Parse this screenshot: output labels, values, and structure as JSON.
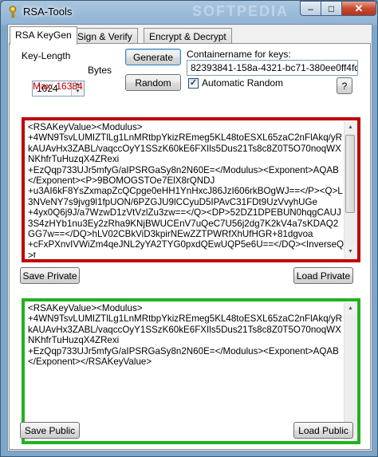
{
  "window": {
    "title": "RSA-Tools",
    "watermark": "SOFTPEDIA",
    "minimize_glyph": "–",
    "maximize_glyph": "□",
    "close_glyph": "✕"
  },
  "tabs": [
    {
      "label": "RSA KeyGen",
      "active": true
    },
    {
      "label": "Sign & Verify",
      "active": false
    },
    {
      "label": "Encrypt & Decrypt",
      "active": false
    }
  ],
  "keygen": {
    "key_length_label": "Key-Length",
    "key_length_value": "1024",
    "bytes_label": "Bytes",
    "max_label": "Max: 16384",
    "generate_button": "Generate",
    "random_button": "Random",
    "container_label": "Containername for keys:",
    "container_value": "82393841-158a-4321-bc71-380ee0ff4fd4",
    "auto_random_label": "Automatic Random",
    "auto_random_checked": true,
    "help_button": "?"
  },
  "private_key": {
    "text": "<RSAKeyValue><Modulus>\n+4WN9TsvLUMIZTlLg1LnMRtbpYkizREmeg5KL48toESXL65zaC2nFlAkq/yRkAUAvHx3ZABL/vaqccOyY1SSzK60kE6FXIls5Dus21Ts8c8Z0T5O70noqWXNKhfrTuHuzqX4ZRexi\n+EzQqp733UJr5mfyG/aIPSRGaSy8n2N60E=</Modulus><Exponent>AQAB</Exponent><P>9BOMOGSTOe7ElX8rQNDJ\n+u3AI6kF8YsZxmapZcQCpge0eHH1YnHxcJ86JzI606rkBOgWJ==</P><Q>L3NVeNY7s9jvg9l1fpUON/6PZGJU9lCCyuD5IPAvC31FDt9UzVvyhUGe\n+4yx0Q6j9J/a7WzwD1zVtVzlZu3zw==</Q><DP>52DZ1DPEBUN0hqgCAUJ3S4zHYb1nu3Ey2zRha9KNjBWUCEnV7uQeC7U56j2dg7K2kV4a7sKDAQ2GG7w==</DQ>hLV02CBkViD3kpirNEwZZTPWRfXhUfHGR+81dgvoa\n+cFxPXnvIVWiZm4qeJNL2yYA2TYG0pxdQEwUQP5e6U==</DQ><InverseQ>t"
  },
  "private_buttons": {
    "save": "Save Private",
    "load": "Load Private"
  },
  "public_key": {
    "text": "<RSAKeyValue><Modulus>\n+4WN9TsvLUMIZTlLg1LnMRtbpYkizREmeg5KL48toESXL65zaC2nFlAkq/yRkAUAvHx3ZABL/vaqccOyY1SSzK60kE6FXIls5Dus21Ts8c8Z0T5O70noqWXNKhfrTuHuzqX4ZRexi\n+EzQqp733UJr5mfyG/aIPSRGaSy8n2N60E=</Modulus><Exponent>AQAB</Exponent></RSAKeyValue>"
  },
  "public_buttons": {
    "save": "Save Public",
    "load": "Load Public"
  },
  "colors": {
    "private_border": "#bf0000",
    "public_border": "#22b21f",
    "max_label": "#c00000"
  }
}
